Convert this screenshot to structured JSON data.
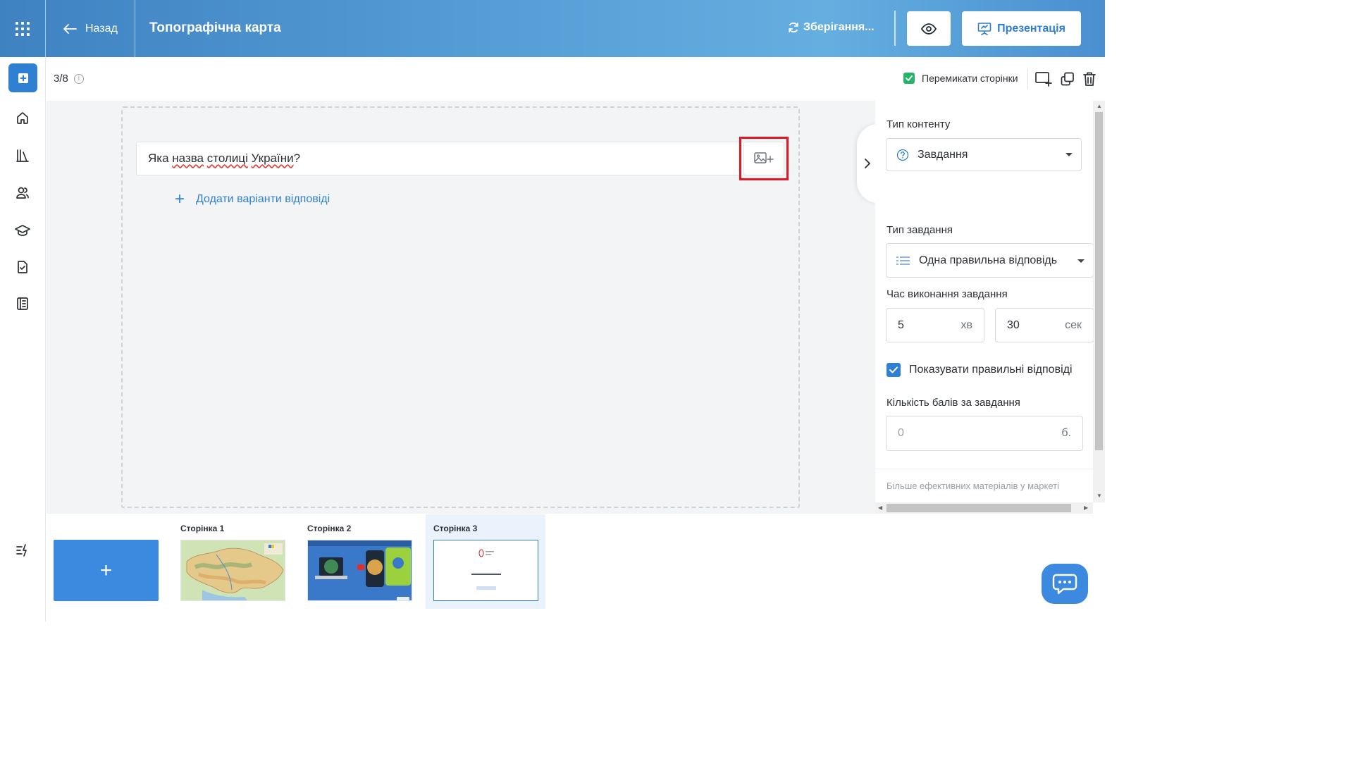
{
  "header": {
    "back_label": "Назад",
    "title": "Топографічна карта",
    "saving_label": "Зберігання...",
    "present_label": "Презентація"
  },
  "toolbar": {
    "page_counter": "3/8",
    "switch_pages_label": "Перемикати сторінки"
  },
  "slide": {
    "question_parts": [
      "Яка ",
      "назва",
      " ",
      "столиці",
      " ",
      "України",
      "?"
    ],
    "add_answers_label": "Додати варіанти відповіді"
  },
  "panel": {
    "content_type_label": "Тип контенту",
    "content_type_value": "Завдання",
    "task_type_label": "Тип завдання",
    "task_type_value": "Одна правильна відповідь",
    "time_label": "Час виконання завдання",
    "minutes_value": "5",
    "minutes_unit": "хв",
    "seconds_value": "30",
    "seconds_unit": "сек",
    "show_correct_label": "Показувати правильні відповіді",
    "show_correct_checked": true,
    "points_label": "Кількість балів за завдання",
    "points_placeholder": "0",
    "points_unit": "б.",
    "market_label": "Більше ефективних матеріалів у маркеті"
  },
  "pages": [
    {
      "label": "Сторінка 1",
      "kind": "map",
      "active": false
    },
    {
      "label": "Сторінка 2",
      "kind": "video",
      "active": false
    },
    {
      "label": "Сторінка 3",
      "kind": "question",
      "active": true
    }
  ],
  "colors": {
    "accent": "#2f7fd3",
    "header_gradient_start": "#3f82c2",
    "header_gradient_end": "#64aee0",
    "highlight_frame": "#e3151f",
    "check_green": "#27b36a"
  }
}
